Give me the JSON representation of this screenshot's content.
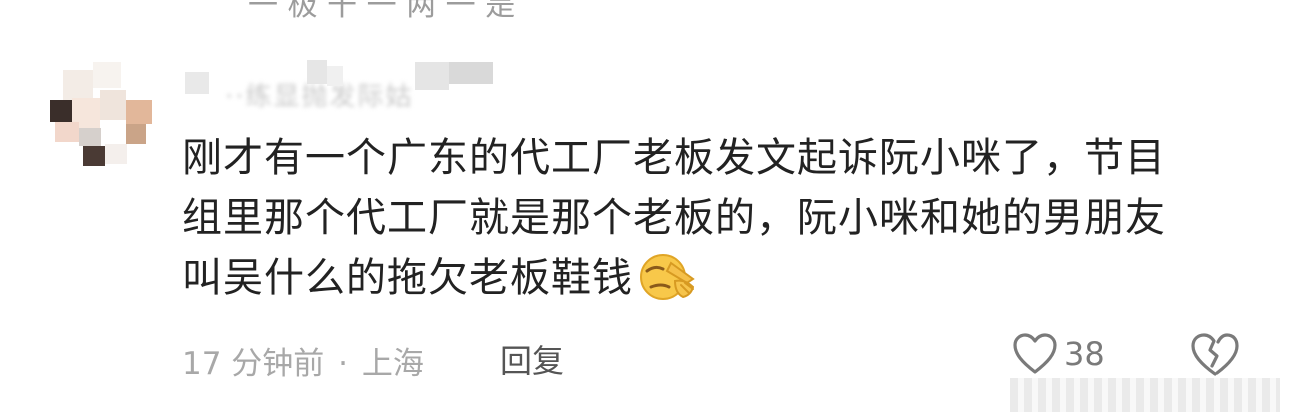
{
  "previous_comment": {
    "partial_text": "一 极 干 一 两 一 是"
  },
  "comment": {
    "username_obscured": "··练显抛发际姑",
    "lines": [
      "刚才有一个广东的代工厂老板发文起诉阮小咪了，节目",
      "组里那个代工厂就是那个老板的，阮小咪和她的男朋友",
      "叫吴什么的拖欠老板鞋钱"
    ],
    "emoji": "facepalm-emoji",
    "time": "17 分钟前",
    "separator": "·",
    "location": "上海",
    "reply_label": "回复",
    "like_count": "38"
  },
  "icons": {
    "like": "heart-outline-icon",
    "dislike": "broken-heart-outline-icon"
  },
  "colors": {
    "text": "#222222",
    "meta": "#a8a8a8",
    "reply": "#555555",
    "icon": "#7a7a7a"
  }
}
